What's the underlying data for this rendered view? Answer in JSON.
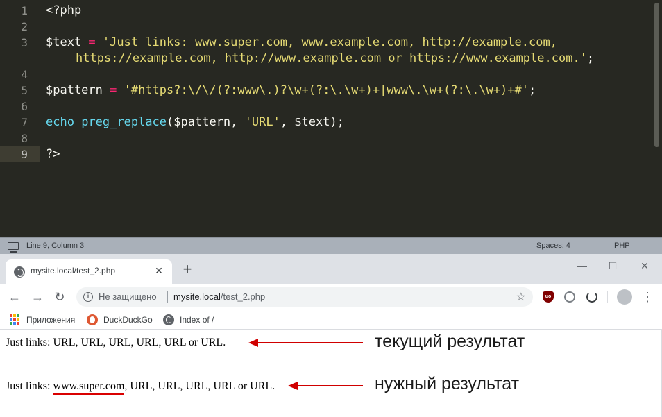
{
  "editor": {
    "line_numbers": [
      "1",
      "2",
      "3",
      "4",
      "5",
      "6",
      "7",
      "8",
      "9"
    ],
    "active_line": "9",
    "lines": {
      "l1": {
        "open": "<?php"
      },
      "l3": {
        "var": "$text",
        "eq": " = ",
        "str_a": "'Just links: www.super.com, www.example.com, http://example.com,"
      },
      "l3b": {
        "str_b": "https://example.com, http://www.example.com or https://www.example.com.'",
        "semi": ";"
      },
      "l5": {
        "var": "$pattern",
        "eq": " = ",
        "str": "'#https?:\\/\\/(?:www\\.)?\\w+(?:\\.\\w+)+|www\\.\\w+(?:\\.\\w+)+#'",
        "semi": ";"
      },
      "l7": {
        "kw": "echo",
        "sp": " ",
        "fn": "preg_replace",
        "p1": "($pattern, ",
        "str": "'URL'",
        "p2": ", $text);"
      },
      "l9": {
        "close": "?>"
      }
    }
  },
  "statusbar": {
    "position": "Line 9, Column 3",
    "spaces": "Spaces: 4",
    "syntax": "PHP"
  },
  "browser": {
    "tab_title": "mysite.local/test_2.php",
    "tab_close": "✕",
    "new_tab": "+",
    "win_minimize": "—",
    "win_maximize": "☐",
    "win_close": "✕",
    "back": "←",
    "forward": "→",
    "reload": "↻",
    "not_secure": "Не защищено",
    "url_host": "mysite.local",
    "url_path": "/test_2.php",
    "star": "☆",
    "menu": "⋮",
    "bookmarks": [
      "Приложения",
      "DuckDuckGo",
      "Index of /"
    ],
    "icons": {
      "tab": "globe-icon",
      "apps": "apps-grid-icon",
      "duckduckgo": "duckduckgo-icon",
      "index": "globe-icon",
      "ublock": "ublock-origin-icon",
      "ext_globe": "globe-extension-icon",
      "ext_sync": "sync-extension-icon",
      "avatar": "profile-avatar-icon"
    },
    "ublock_label": "uo"
  },
  "page": {
    "current": {
      "text": "Just links: URL, URL, URL, URL, URL or URL.",
      "note": "текущий результат"
    },
    "desired": {
      "link": "www.super.com",
      "rest": ", URL, URL, URL, URL or URL.",
      "prefix": "Just links: ",
      "note": "нужный результат"
    }
  },
  "colors": {
    "editor_bg": "#272822",
    "keyword": "#f92672",
    "string": "#e6db74",
    "function": "#66d9ef",
    "call": "#a6e22e",
    "annotation_red": "#d00000"
  }
}
